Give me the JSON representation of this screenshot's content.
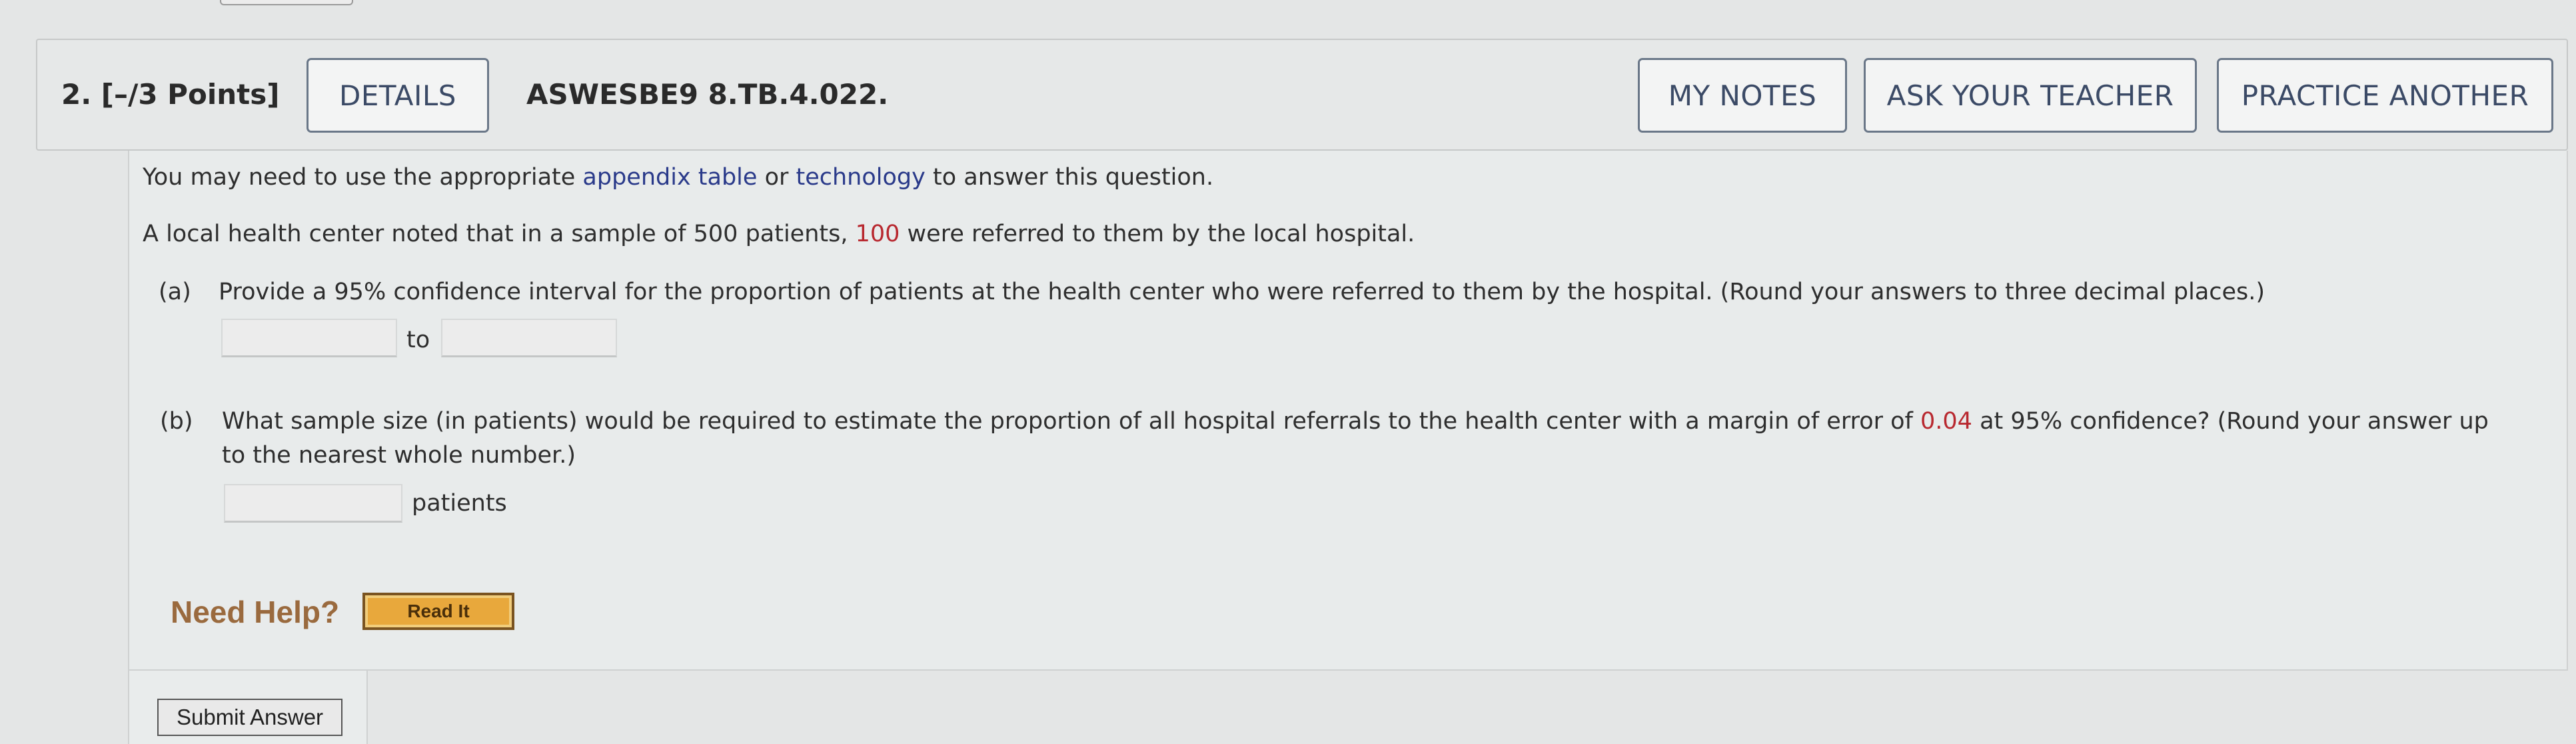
{
  "header": {
    "question_number": "2.  [–/3 Points]",
    "details_label": "DETAILS",
    "question_code": "ASWESBE9 8.TB.4.022.",
    "my_notes_label": "MY NOTES",
    "ask_teacher_label": "ASK YOUR TEACHER",
    "practice_another_label": "PRACTICE ANOTHER"
  },
  "question": {
    "intro_before": "You may need to use the appropriate ",
    "intro_link1": "appendix table",
    "intro_mid": " or ",
    "intro_link2": "technology",
    "intro_after": " to answer this question.",
    "stem_before": "A local health center noted that in a sample of 500 patients, ",
    "stem_value": "100",
    "stem_after": " were referred to them by the local hospital.",
    "part_a": {
      "label": "(a)",
      "text": "Provide a 95% confidence interval for the proportion of patients at the health center who were referred to them by the hospital. (Round your answers to three decimal places.)",
      "lower_value": "",
      "upper_value": "",
      "to_label": "to"
    },
    "part_b": {
      "label": "(b)",
      "text_before": "What sample size (in patients) would be required to estimate the proportion of all hospital referrals to the health center with a margin of error of ",
      "margin": "0.04",
      "text_after": " at 95% confidence? (Round your answer up",
      "text_line2": "to the nearest whole number.)",
      "answer_value": "",
      "unit_label": "patients"
    }
  },
  "help": {
    "need_help_label": "Need Help?",
    "read_it_label": "Read It"
  },
  "submit_label": "Submit Answer"
}
